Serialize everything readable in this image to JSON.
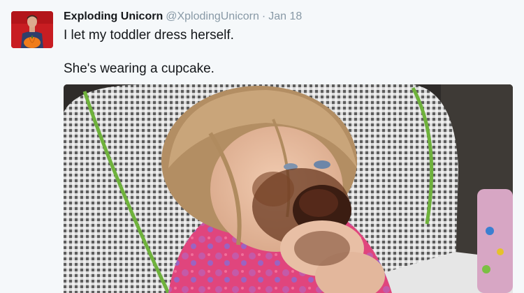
{
  "tweet": {
    "author_name": "Exploding Unicorn",
    "author_handle": "@XplodingUnicorn",
    "separator": "·",
    "date": "Jan 18",
    "text_line1": "I let my toddler dress herself.",
    "text_line2": "She's wearing a cupcake."
  },
  "icons": {
    "avatar": "avatar-photo-icon",
    "media": "tweet-photo"
  },
  "colors": {
    "name": "#14171a",
    "meta": "#8899a6",
    "background": "#f5f8fa"
  }
}
